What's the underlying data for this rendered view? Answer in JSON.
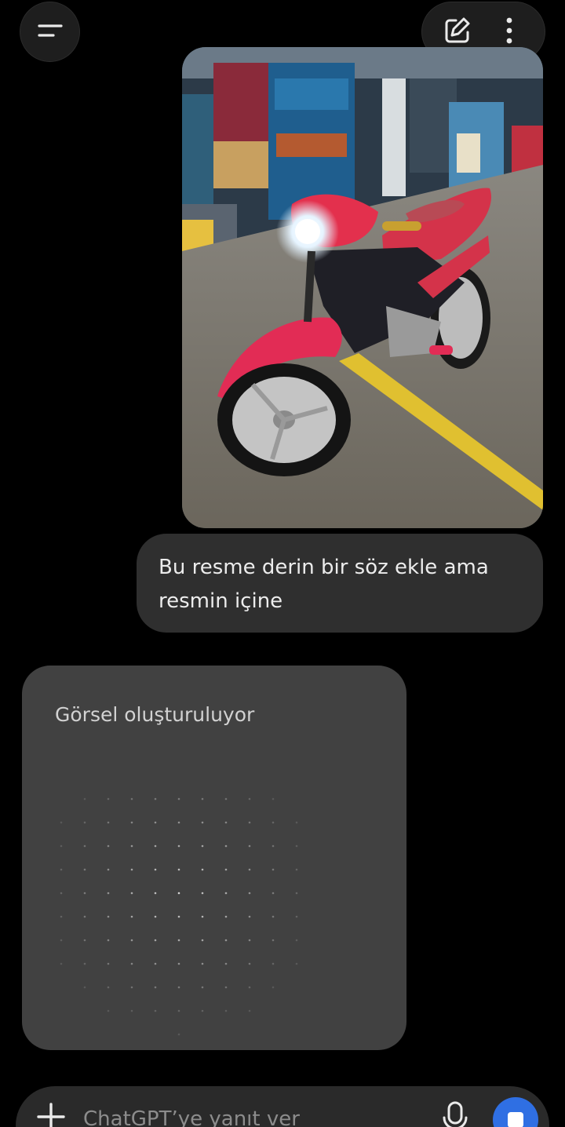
{
  "header": {
    "menu_icon": "menu-icon",
    "new_chat_icon": "edit-icon",
    "more_icon": "more-vertical-icon"
  },
  "conversation": {
    "user_image_description_icon": "photo",
    "user_message": "Bu resme derin bir söz ekle ama resmin içine",
    "assistant_status": "Görsel oluşturuluyor"
  },
  "composer": {
    "placeholder": "ChatGPT’ye yanıt ver",
    "plus_icon": "plus-icon",
    "mic_icon": "mic-icon",
    "stop_icon": "stop-icon"
  },
  "colors": {
    "background": "#000000",
    "bubble": "#2f2f2f",
    "card": "#414141",
    "accent": "#2f6fe3"
  }
}
